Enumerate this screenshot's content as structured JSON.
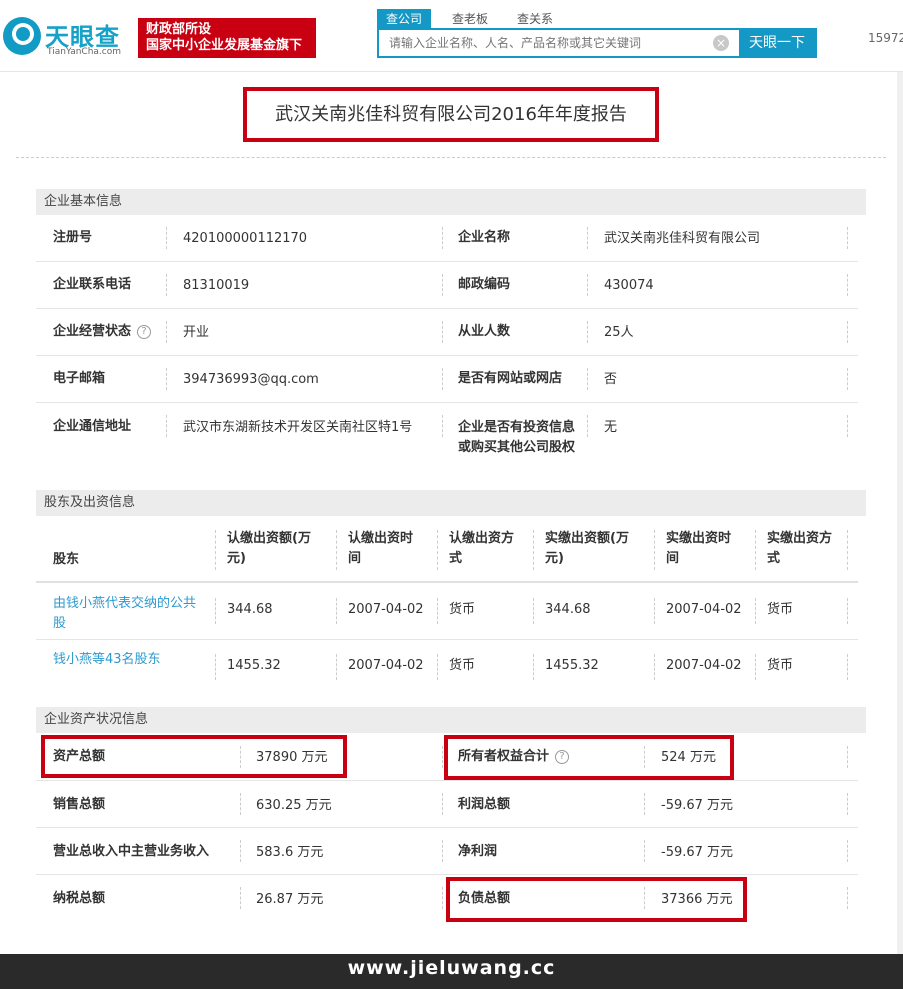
{
  "header": {
    "logo_cn": "天眼查",
    "logo_en": "TianYanCha.com",
    "badge_line1": "财政部所设",
    "badge_line2": "国家中小企业发展基金旗下",
    "tabs": [
      "查公司",
      "查老板",
      "查关系"
    ],
    "search_placeholder": "请输入企业名称、人名、产品名称或其它关键词",
    "search_button": "天眼一下",
    "phone": "15972"
  },
  "title": "武汉关南兆佳科贸有限公司2016年年度报告",
  "basic": {
    "heading": "企业基本信息",
    "rows": [
      {
        "l1": "注册号",
        "v1": "420100000112170",
        "l2": "企业名称",
        "v2": "武汉关南兆佳科贸有限公司"
      },
      {
        "l1": "企业联系电话",
        "v1": "81310019",
        "l2": "邮政编码",
        "v2": "430074"
      },
      {
        "l1": "企业经营状态",
        "v1": "开业",
        "l2": "从业人数",
        "v2": "25人"
      },
      {
        "l1": "电子邮箱",
        "v1": "394736993@qq.com",
        "l2": "是否有网站或网店",
        "v2": "否"
      },
      {
        "l1": "企业通信地址",
        "v1": "武汉市东湖新技术开发区关南社区特1号",
        "l2a": "企业是否有投资信息",
        "l2b": "或购买其他公司股权",
        "v2": "无"
      }
    ],
    "help_icon": "?"
  },
  "shareholders": {
    "heading": "股东及出资信息",
    "columns": [
      [
        "股东"
      ],
      [
        "认缴出资额(万",
        "元)"
      ],
      [
        "认缴出资时",
        "间"
      ],
      [
        "认缴出资方",
        "式"
      ],
      [
        "实缴出资额(万",
        "元)"
      ],
      [
        "实缴出资时",
        "间"
      ],
      [
        "实缴出资方",
        "式"
      ]
    ],
    "rows": [
      {
        "name_a": "由钱小燕代表交纳的公共",
        "name_b": "股",
        "sub_amt": "344.68",
        "sub_date": "2007-04-02",
        "sub_way": "货币",
        "paid_amt": "344.68",
        "paid_date": "2007-04-02",
        "paid_way": "货币"
      },
      {
        "name_a": "钱小燕等43名股东",
        "name_b": "",
        "sub_amt": "1455.32",
        "sub_date": "2007-04-02",
        "sub_way": "货币",
        "paid_amt": "1455.32",
        "paid_date": "2007-04-02",
        "paid_way": "货币"
      }
    ]
  },
  "assets": {
    "heading": "企业资产状况信息",
    "rows": [
      {
        "l1": "资产总额",
        "v1": "37890 万元",
        "l2": "所有者权益合计",
        "v2": "524 万元"
      },
      {
        "l1": "销售总额",
        "v1": "630.25 万元",
        "l2": "利润总额",
        "v2": "-59.67 万元"
      },
      {
        "l1": "营业总收入中主营业务收入",
        "v1": "583.6 万元",
        "l2": "净利润",
        "v2": "-59.67 万元"
      },
      {
        "l1": "纳税总额",
        "v1": "26.87 万元",
        "l2": "负债总额",
        "v2": "37366 万元"
      }
    ]
  },
  "watermark": "www.jieluwang.cc"
}
